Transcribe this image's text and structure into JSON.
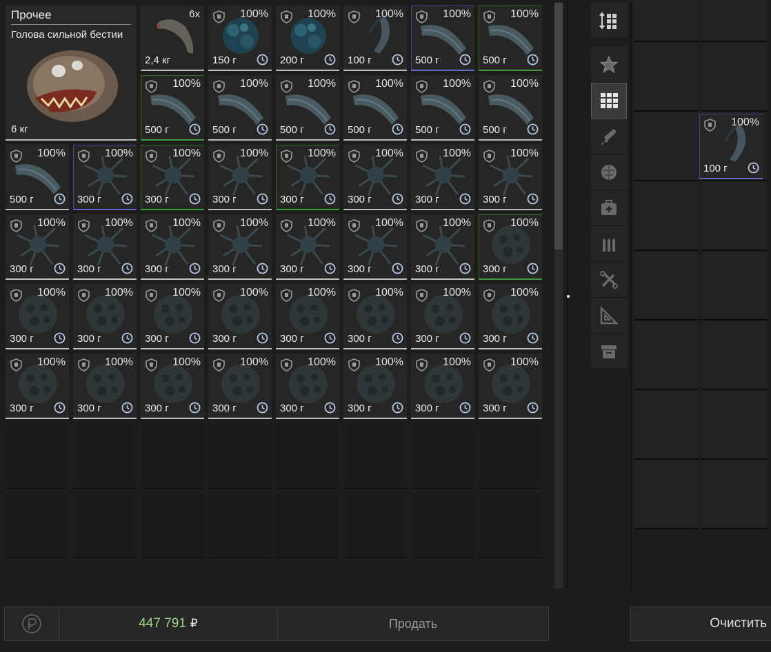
{
  "big_item": {
    "category": "Прочее",
    "name": "Голова сильной бестии",
    "weight": "6 кг"
  },
  "stack_item": {
    "count": "6x",
    "weight": "2,4 кг"
  },
  "row1_rest": [
    {
      "durability": "100%",
      "weight": "150 г",
      "art": "coral",
      "border": "normal"
    },
    {
      "durability": "100%",
      "weight": "200 г",
      "art": "coral",
      "border": "normal"
    },
    {
      "durability": "100%",
      "weight": "100 г",
      "art": "claw",
      "border": "normal"
    },
    {
      "durability": "100%",
      "weight": "500 г",
      "art": "feather",
      "border": "blue"
    },
    {
      "durability": "100%",
      "weight": "500 г",
      "art": "feather",
      "border": "green"
    }
  ],
  "row2_rest": [
    {
      "durability": "100%",
      "weight": "500 г",
      "art": "feather",
      "border": "green"
    },
    {
      "durability": "100%",
      "weight": "500 г",
      "art": "feather",
      "border": "normal"
    },
    {
      "durability": "100%",
      "weight": "500 г",
      "art": "feather",
      "border": "normal"
    },
    {
      "durability": "100%",
      "weight": "500 г",
      "art": "feather",
      "border": "normal"
    },
    {
      "durability": "100%",
      "weight": "500 г",
      "art": "feather",
      "border": "normal"
    },
    {
      "durability": "100%",
      "weight": "500 г",
      "art": "feather",
      "border": "normal"
    }
  ],
  "rows": [
    [
      {
        "durability": "100%",
        "weight": "500 г",
        "art": "feather",
        "border": "normal"
      },
      {
        "durability": "100%",
        "weight": "300 г",
        "art": "spiky",
        "border": "blue"
      },
      {
        "durability": "100%",
        "weight": "300 г",
        "art": "spiky",
        "border": "green"
      },
      {
        "durability": "100%",
        "weight": "300 г",
        "art": "spiky",
        "border": "normal"
      },
      {
        "durability": "100%",
        "weight": "300 г",
        "art": "spiky",
        "border": "green"
      },
      {
        "durability": "100%",
        "weight": "300 г",
        "art": "spiky",
        "border": "normal"
      },
      {
        "durability": "100%",
        "weight": "300 г",
        "art": "spiky",
        "border": "normal"
      },
      {
        "durability": "100%",
        "weight": "300 г",
        "art": "spiky",
        "border": "normal"
      }
    ],
    [
      {
        "durability": "100%",
        "weight": "300 г",
        "art": "spiky",
        "border": "normal"
      },
      {
        "durability": "100%",
        "weight": "300 г",
        "art": "spiky",
        "border": "normal"
      },
      {
        "durability": "100%",
        "weight": "300 г",
        "art": "spiky",
        "border": "normal"
      },
      {
        "durability": "100%",
        "weight": "300 г",
        "art": "spiky",
        "border": "normal"
      },
      {
        "durability": "100%",
        "weight": "300 г",
        "art": "spiky",
        "border": "normal"
      },
      {
        "durability": "100%",
        "weight": "300 г",
        "art": "spiky",
        "border": "normal"
      },
      {
        "durability": "100%",
        "weight": "300 г",
        "art": "spiky",
        "border": "normal"
      },
      {
        "durability": "100%",
        "weight": "300 г",
        "art": "rock",
        "border": "green"
      }
    ],
    [
      {
        "durability": "100%",
        "weight": "300 г",
        "art": "rock",
        "border": "normal"
      },
      {
        "durability": "100%",
        "weight": "300 г",
        "art": "rock",
        "border": "normal"
      },
      {
        "durability": "100%",
        "weight": "300 г",
        "art": "rock",
        "border": "normal"
      },
      {
        "durability": "100%",
        "weight": "300 г",
        "art": "rock",
        "border": "normal"
      },
      {
        "durability": "100%",
        "weight": "300 г",
        "art": "rock",
        "border": "normal"
      },
      {
        "durability": "100%",
        "weight": "300 г",
        "art": "rock",
        "border": "normal"
      },
      {
        "durability": "100%",
        "weight": "300 г",
        "art": "rock",
        "border": "normal"
      },
      {
        "durability": "100%",
        "weight": "300 г",
        "art": "rock",
        "border": "normal"
      }
    ],
    [
      {
        "durability": "100%",
        "weight": "300 г",
        "art": "rock",
        "border": "normal"
      },
      {
        "durability": "100%",
        "weight": "300 г",
        "art": "rock",
        "border": "normal"
      },
      {
        "durability": "100%",
        "weight": "300 г",
        "art": "rock",
        "border": "normal"
      },
      {
        "durability": "100%",
        "weight": "300 г",
        "art": "rock",
        "border": "normal"
      },
      {
        "durability": "100%",
        "weight": "300 г",
        "art": "rock",
        "border": "normal"
      },
      {
        "durability": "100%",
        "weight": "300 г",
        "art": "rock",
        "border": "normal"
      },
      {
        "durability": "100%",
        "weight": "300 г",
        "art": "rock",
        "border": "normal"
      },
      {
        "durability": "100%",
        "weight": "300 г",
        "art": "rock",
        "border": "normal"
      }
    ]
  ],
  "sell_item": {
    "durability": "100%",
    "weight": "100 г",
    "art": "claw"
  },
  "tabs": [
    {
      "icon": "sort-icon"
    },
    {
      "icon": "star-icon"
    },
    {
      "icon": "grid-icon",
      "active": true
    },
    {
      "icon": "weapon-icon"
    },
    {
      "icon": "armor-icon"
    },
    {
      "icon": "medkit-icon"
    },
    {
      "icon": "ammo-icon"
    },
    {
      "icon": "tools-icon"
    },
    {
      "icon": "drawing-icon"
    },
    {
      "icon": "container-icon"
    }
  ],
  "bottom": {
    "total": "447 791",
    "currency": "₽",
    "sell_label": "Продать",
    "clear_label": "Очистить"
  },
  "colors": {
    "accent_green": "#9fd48a",
    "quality_green": "#3f9a3f",
    "quality_blue": "#6464c8"
  }
}
